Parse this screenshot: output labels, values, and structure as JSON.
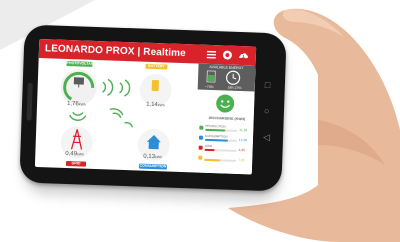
{
  "app": {
    "title": "LEONARDO PROX",
    "separator": "|",
    "view": "Realtime",
    "header_icons": [
      "list-icon",
      "settings-icon",
      "cloud-icon"
    ]
  },
  "nodes": {
    "photovoltaic": {
      "label": "PHOTOVOLTAIC",
      "value": "1,76",
      "unit": "kWh",
      "color": "#4caf50"
    },
    "battery": {
      "label": "BATTERY",
      "value": "1,14",
      "unit": "kWh",
      "color": "#f2c12e"
    },
    "grid": {
      "label": "GRID",
      "value": "0,49",
      "unit": "kWh",
      "color": "#d8232a"
    },
    "consumption": {
      "label": "CONSUMPTION",
      "value": "0,13",
      "unit": "kWh",
      "color": "#2b8fd6"
    }
  },
  "panel": {
    "available_energy": "AVAILABLE ENERGY",
    "left_pct": "~70%",
    "right_pct": "58h 23%",
    "status_face": "smiley-icon",
    "summary_title": "DISCHARGING (KWH)",
    "rows": [
      {
        "label": "PRODUCTION",
        "value": "11,18",
        "fill": 0.62,
        "color": "#4caf50",
        "icon": "sun-icon"
      },
      {
        "label": "CONSUMPTION",
        "value": "12,35",
        "fill": 0.72,
        "color": "#2b8fd6",
        "icon": "house-icon"
      },
      {
        "label": "GRID",
        "value": "1,95",
        "fill": 0.32,
        "color": "#d8232a",
        "icon": "grid-tower-icon"
      },
      {
        "label": "",
        "value": "7,06",
        "fill": 0.5,
        "color": "#f2c12e",
        "icon": "battery-icon"
      }
    ]
  },
  "colors": {
    "accent": "#d8232a",
    "green": "#4caf50",
    "yellow": "#f2c12e",
    "blue": "#2b8fd6"
  }
}
